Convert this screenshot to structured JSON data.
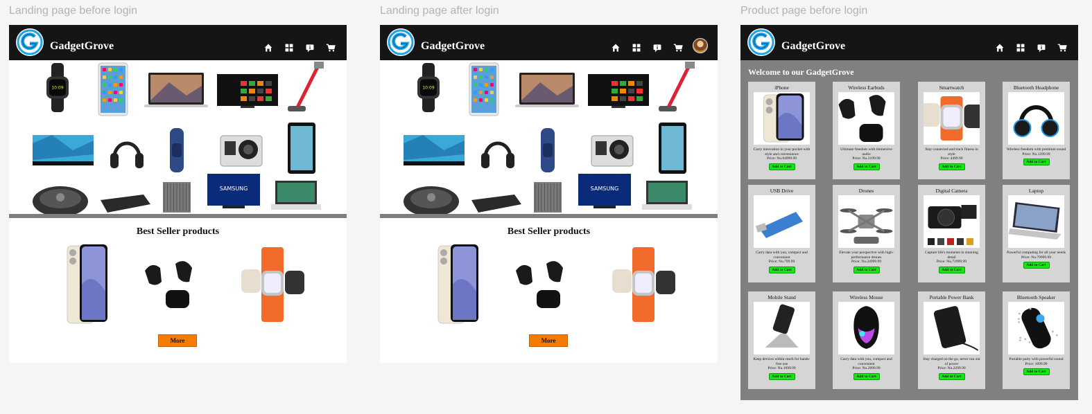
{
  "frames": [
    {
      "label": "Landing page before login"
    },
    {
      "label": "Landing page after login"
    },
    {
      "label": "Product page before login"
    }
  ],
  "brand": "GadgetGrove",
  "nav_icons": [
    "home-icon",
    "grid-icon",
    "info-icon",
    "cart-icon"
  ],
  "colors": {
    "header_bg": "#151515",
    "logo_ring": "#1aa3e8",
    "more_button": "#f57c00",
    "add_to_cart": "#16e616",
    "product_area_bg": "#808080",
    "card_bg": "#d5d5d5"
  },
  "landing": {
    "best_title": "Best Seller products",
    "best_items": [
      "iphone-image",
      "wireless-earbuds-image",
      "smartwatch-image"
    ],
    "more_label": "More"
  },
  "product_page": {
    "welcome": "Welcome to our GadgetGrove",
    "add_to_cart_label": "Add to Cart",
    "products": [
      {
        "name": "iPhone",
        "desc": "Carry innovation in your pocket with style and convenience",
        "price": "Price: Nu.84999.99"
      },
      {
        "name": "Wireless Earbuds",
        "desc": "Ultimate freedom with immersive audio",
        "price": "Price: Nu.2199.99"
      },
      {
        "name": "Smartwatch",
        "desc": "Stay connected and track fitness in style",
        "price": "Price: 4499.99"
      },
      {
        "name": "Bluetooth Headphone",
        "desc": "Wireless freedom with premium sound",
        "price": "Price: Nu.1299.99"
      },
      {
        "name": "USB Drive",
        "desc": "Carry data with you, compact and convenient",
        "price": "Price: Nu.799.99"
      },
      {
        "name": "Drones",
        "desc": "Elevate your perspective with high-performance drones",
        "price": "Price: Nu.24999.99"
      },
      {
        "name": "Digital Camera",
        "desc": "Capture life's moments in stunning detail",
        "price": "Price: Nu.72999.99"
      },
      {
        "name": "Laptop",
        "desc": "Powerful computing for all your needs",
        "price": "Price: Nu.79999.99"
      },
      {
        "name": "Mobile Stand",
        "desc": "Keep devices within reach for hands-free use",
        "price": "Price: Nu.1099.99"
      },
      {
        "name": "Wireless Mouse",
        "desc": "Carry data with you, compact and convenient",
        "price": "Price: Nu.2099.99"
      },
      {
        "name": "Portable Power Bank",
        "desc": "Stay charged on the go, never run out of power",
        "price": "Price: Nu.2299.99"
      },
      {
        "name": "Bluetooth Speaker",
        "desc": "Portable party with powerful sound",
        "price": "Price: 1699.99"
      }
    ]
  }
}
